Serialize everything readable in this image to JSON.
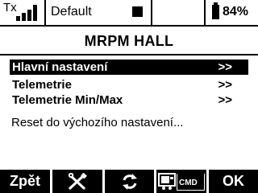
{
  "status": {
    "tx_label": "Tx",
    "signal_icon": "signal-bars-icon",
    "model_name": "Default",
    "model_indicator": "square-icon",
    "battery_icon": "battery-icon",
    "battery_percent": "84%"
  },
  "page": {
    "title": "MRPM HALL"
  },
  "menu": {
    "items": [
      {
        "label": "Hlavní nastavení",
        "arrow": ">>",
        "selected": true
      },
      {
        "label": "Telemetrie",
        "arrow": ">>",
        "selected": false
      },
      {
        "label": "Telemetrie Min/Max",
        "arrow": ">>",
        "selected": false
      }
    ],
    "reset_label": "Reset do výchozího nastavení..."
  },
  "softkeys": {
    "back_label": "Zpět",
    "tools_icon": "tools-icon",
    "refresh_icon": "refresh-icon",
    "cmd_icon": "cmd-icon",
    "cmd_label": "CMD",
    "ok_label": "OK"
  },
  "colors": {
    "foreground": "#000000",
    "background": "#ffffff"
  }
}
